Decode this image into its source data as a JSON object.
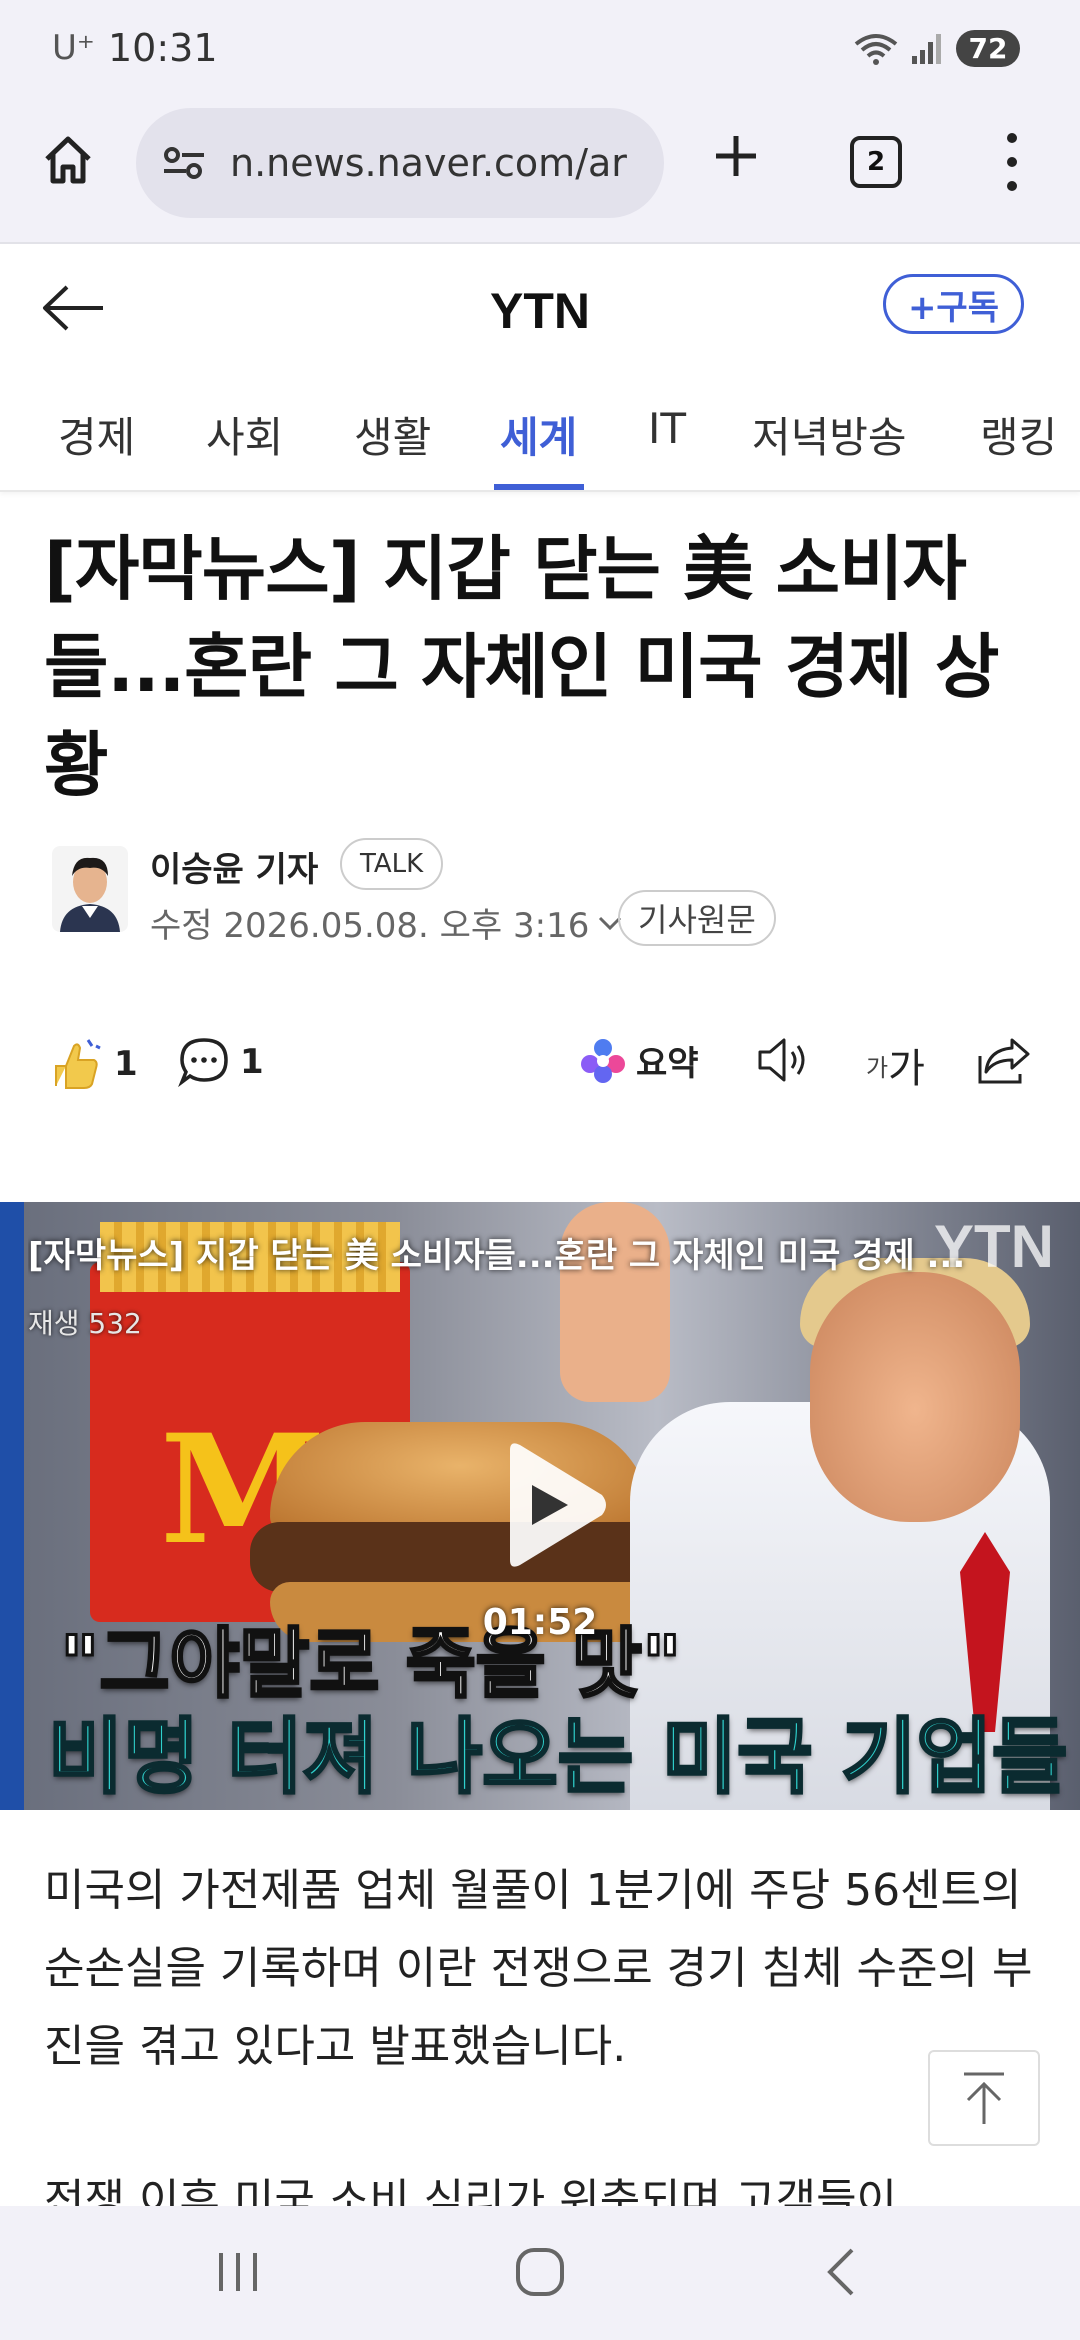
{
  "status_bar": {
    "carrier": "U⁺",
    "time": "10:31",
    "battery": "72"
  },
  "browser": {
    "url": "n.news.naver.com/ar",
    "tab_count": "2"
  },
  "site": {
    "brand": "YTN",
    "subscribe_label": "+구독"
  },
  "categories": [
    {
      "label": "경제",
      "active": false
    },
    {
      "label": "사회",
      "active": false
    },
    {
      "label": "생활",
      "active": false
    },
    {
      "label": "세계",
      "active": true
    },
    {
      "label": "IT",
      "active": false
    },
    {
      "label": "저녁방송",
      "active": false
    },
    {
      "label": "랭킹",
      "active": false
    }
  ],
  "article": {
    "headline": "[자막뉴스] 지갑 닫는 美 소비자들...혼란 그 자체인 미국 경제 상황",
    "reporter": "이승윤 기자",
    "talk_label": "TALK",
    "date": "수정 2026.05.08. 오후 3:16",
    "source_label": "기사원문",
    "body_text": "미국의 가전제품 업체 월풀이 1분기에 주당 56센트의 순손실을 기록하며 이란 전쟁으로 경기 침체 수준의 부진을 겪고 있다고 발표했습니다.",
    "body_text_2": "전쟁 이후 미국 소비 심리가 위축되며 고객들이"
  },
  "actions": {
    "like_count": "1",
    "comment_count": "1",
    "summary_label": "요약",
    "font_small": "가",
    "font_large": "가"
  },
  "video": {
    "title": "[자막뉴스] 지갑 닫는 美 소비자들...혼란 그 자체인 미국 경제 ...",
    "views": "재생 532",
    "logo": "YTN",
    "duration": "01:52",
    "caption_line1": "\"그야말로 죽을 맛\"",
    "caption_line2": "비명 터져 나오는 미국 기업들"
  },
  "colors": {
    "accent": "#3f5fd6",
    "chrome_bg": "#f2f1f8"
  }
}
